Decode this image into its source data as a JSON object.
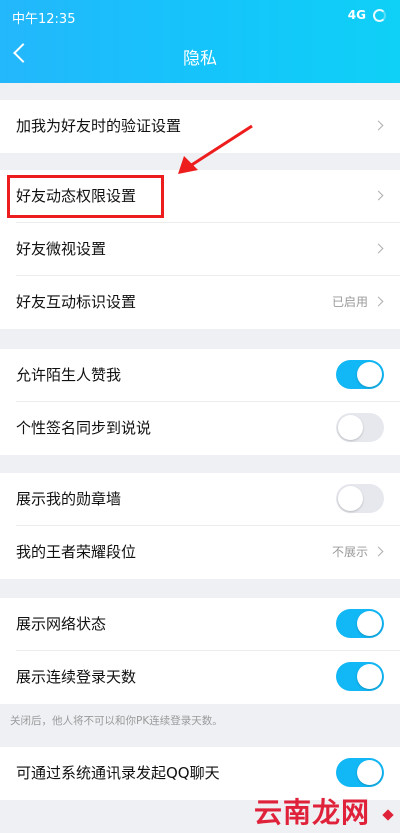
{
  "status_bar": {
    "time": "中午12:35",
    "network": "4G"
  },
  "header": {
    "title": "隐私"
  },
  "sections": [
    {
      "items": [
        {
          "label": "加我为好友时的验证设置",
          "control": "chevron"
        }
      ]
    },
    {
      "items": [
        {
          "label": "好友动态权限设置",
          "control": "chevron",
          "highlighted": true
        },
        {
          "label": "好友微视设置",
          "control": "chevron"
        },
        {
          "label": "好友互动标识设置",
          "value": "已启用",
          "control": "chevron"
        }
      ]
    },
    {
      "items": [
        {
          "label": "允许陌生人赞我",
          "control": "toggle",
          "on": true
        },
        {
          "label": "个性签名同步到说说",
          "control": "toggle",
          "on": false
        }
      ]
    },
    {
      "items": [
        {
          "label": "展示我的勋章墙",
          "control": "toggle",
          "on": false
        },
        {
          "label": "我的王者荣耀段位",
          "value": "不展示",
          "control": "chevron"
        }
      ]
    },
    {
      "items": [
        {
          "label": "展示网络状态",
          "control": "toggle",
          "on": true
        },
        {
          "label": "展示连续登录天数",
          "control": "toggle",
          "on": true
        }
      ]
    },
    {
      "items": [
        {
          "label": "可通过系统通讯录发起QQ聊天",
          "control": "toggle",
          "on": true
        }
      ]
    }
  ],
  "hint_text": "关闭后，他人将不可以和你PK连续登录天数。",
  "annotation": {
    "color": "#ee1d1d"
  },
  "colors": {
    "accent": "#12b7f5",
    "header": "#23b7fb"
  },
  "watermark": "云南龙网"
}
